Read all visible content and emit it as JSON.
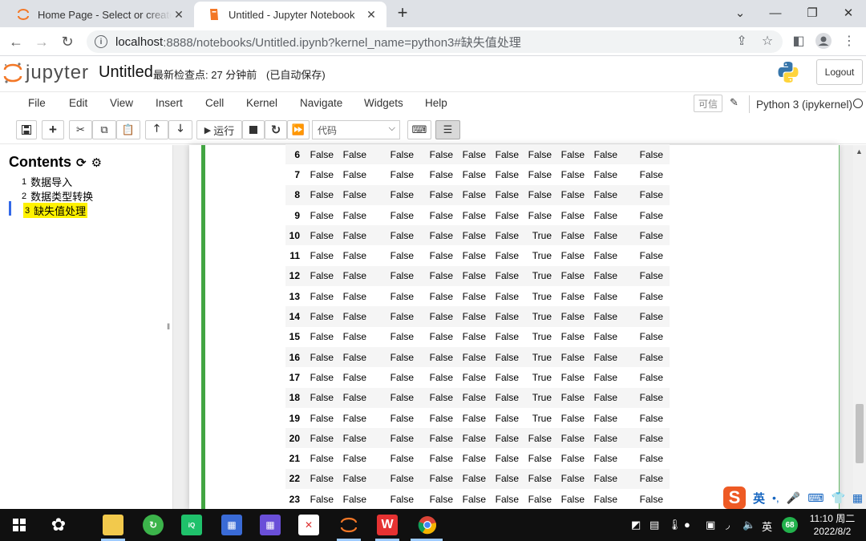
{
  "browser": {
    "tabs": [
      {
        "title": "Home Page - Select or create a notebook",
        "active": false
      },
      {
        "title": "Untitled - Jupyter Notebook",
        "active": true
      }
    ],
    "url_host": "localhost",
    "url_rest": ":8888/notebooks/Untitled.ipynb?kernel_name=python3#缺失值处理"
  },
  "jupyter": {
    "logo_text": "jupyter",
    "notebook_title": "Untitled",
    "checkpoint": "最新检查点: 27 分钟前",
    "autosave": "(已自动保存)",
    "logout": "Logout",
    "menu": [
      "File",
      "Edit",
      "View",
      "Insert",
      "Cell",
      "Kernel",
      "Navigate",
      "Widgets",
      "Help"
    ],
    "trusted": "可信",
    "kernel_name": "Python 3 (ipykernel)",
    "run_label": "运行",
    "cell_type": "代码"
  },
  "toc": {
    "title": "Contents",
    "items": [
      {
        "num": "1",
        "label": "数据导入"
      },
      {
        "num": "2",
        "label": "数据类型转换"
      },
      {
        "num": "3",
        "label": "缺失值处理"
      }
    ]
  },
  "dataframe": {
    "rows": [
      {
        "idx": "6",
        "cells": [
          "False",
          "False",
          "False",
          "False",
          "False",
          "False",
          "False",
          "False",
          "False",
          "False"
        ]
      },
      {
        "idx": "7",
        "cells": [
          "False",
          "False",
          "False",
          "False",
          "False",
          "False",
          "False",
          "False",
          "False",
          "False"
        ]
      },
      {
        "idx": "8",
        "cells": [
          "False",
          "False",
          "False",
          "False",
          "False",
          "False",
          "False",
          "False",
          "False",
          "False"
        ]
      },
      {
        "idx": "9",
        "cells": [
          "False",
          "False",
          "False",
          "False",
          "False",
          "False",
          "False",
          "False",
          "False",
          "False"
        ]
      },
      {
        "idx": "10",
        "cells": [
          "False",
          "False",
          "False",
          "False",
          "False",
          "False",
          "True",
          "False",
          "False",
          "False"
        ]
      },
      {
        "idx": "11",
        "cells": [
          "False",
          "False",
          "False",
          "False",
          "False",
          "False",
          "True",
          "False",
          "False",
          "False"
        ]
      },
      {
        "idx": "12",
        "cells": [
          "False",
          "False",
          "False",
          "False",
          "False",
          "False",
          "True",
          "False",
          "False",
          "False"
        ]
      },
      {
        "idx": "13",
        "cells": [
          "False",
          "False",
          "False",
          "False",
          "False",
          "False",
          "True",
          "False",
          "False",
          "False"
        ]
      },
      {
        "idx": "14",
        "cells": [
          "False",
          "False",
          "False",
          "False",
          "False",
          "False",
          "True",
          "False",
          "False",
          "False"
        ]
      },
      {
        "idx": "15",
        "cells": [
          "False",
          "False",
          "False",
          "False",
          "False",
          "False",
          "True",
          "False",
          "False",
          "False"
        ]
      },
      {
        "idx": "16",
        "cells": [
          "False",
          "False",
          "False",
          "False",
          "False",
          "False",
          "True",
          "False",
          "False",
          "False"
        ]
      },
      {
        "idx": "17",
        "cells": [
          "False",
          "False",
          "False",
          "False",
          "False",
          "False",
          "True",
          "False",
          "False",
          "False"
        ]
      },
      {
        "idx": "18",
        "cells": [
          "False",
          "False",
          "False",
          "False",
          "False",
          "False",
          "True",
          "False",
          "False",
          "False"
        ]
      },
      {
        "idx": "19",
        "cells": [
          "False",
          "False",
          "False",
          "False",
          "False",
          "False",
          "True",
          "False",
          "False",
          "False"
        ]
      },
      {
        "idx": "20",
        "cells": [
          "False",
          "False",
          "False",
          "False",
          "False",
          "False",
          "False",
          "False",
          "False",
          "False"
        ]
      },
      {
        "idx": "21",
        "cells": [
          "False",
          "False",
          "False",
          "False",
          "False",
          "False",
          "False",
          "False",
          "False",
          "False"
        ]
      },
      {
        "idx": "22",
        "cells": [
          "False",
          "False",
          "False",
          "False",
          "False",
          "False",
          "False",
          "False",
          "False",
          "False"
        ]
      },
      {
        "idx": "23",
        "cells": [
          "False",
          "False",
          "False",
          "False",
          "False",
          "False",
          "False",
          "False",
          "False",
          "False"
        ]
      }
    ]
  },
  "ime": {
    "lang": "英"
  },
  "taskbar": {
    "tray_lang": "英",
    "badge": "68",
    "time": "11:10 周二",
    "date": "2022/8/2"
  },
  "colors": {
    "cell_selected_border": "#42a542",
    "toc_highlight": "#fff200",
    "taskbar_bg": "#101010"
  }
}
